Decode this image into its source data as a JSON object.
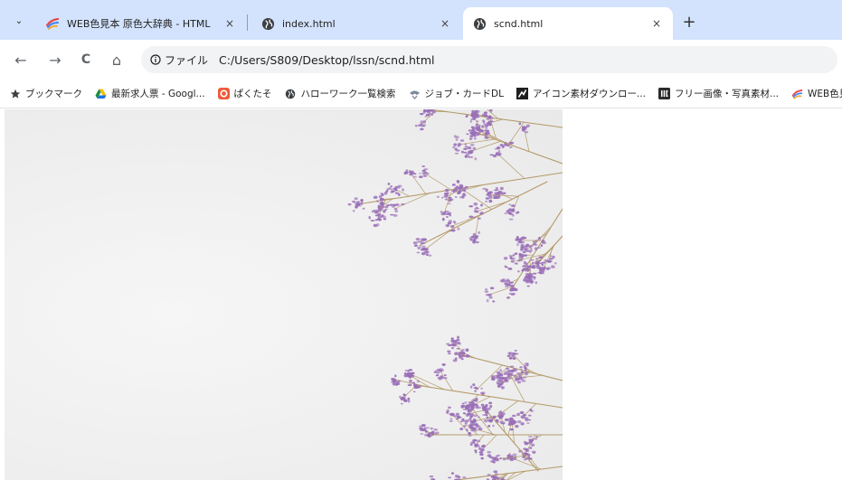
{
  "tabs": [
    {
      "title": "WEB色見本 原色大辞典 - HTML",
      "close": "×",
      "active": false,
      "icon": "web-iro-favicon-icon"
    },
    {
      "title": "index.html",
      "close": "×",
      "active": false,
      "icon": "globe-icon"
    },
    {
      "title": "scnd.html",
      "close": "×",
      "active": true,
      "icon": "globe-icon"
    }
  ],
  "new_tab": "+",
  "tab_search": "⌄",
  "toolbar": {
    "back": "←",
    "forward": "→",
    "reload": "C",
    "home": "⌂",
    "site_info_label": "ファイル",
    "url": "C:/Users/S809/Desktop/lssn/scnd.html"
  },
  "bookmarks": [
    {
      "label": "ブックマーク",
      "icon": "star-icon"
    },
    {
      "label": "最新求人票 - Googl...",
      "icon": "google-drive-icon"
    },
    {
      "label": "ぱくたそ",
      "icon": "pakutaso-icon"
    },
    {
      "label": "ハローワーク一覧検索",
      "icon": "globe-icon"
    },
    {
      "label": "ジョブ・カードDL",
      "icon": "job-card-icon"
    },
    {
      "label": "アイコン素材ダウンロー...",
      "icon": "icon-site-icon"
    },
    {
      "label": "フリー画像・写真素材...",
      "icon": "lig-icon"
    },
    {
      "label": "WEB色見",
      "icon": "web-iro-favicon-icon"
    }
  ],
  "colors": {
    "tabstrip": "#d3e3fd",
    "flower": "#9a6fb8",
    "stem": "#b59a6a",
    "photo_bg": "#efefef"
  }
}
